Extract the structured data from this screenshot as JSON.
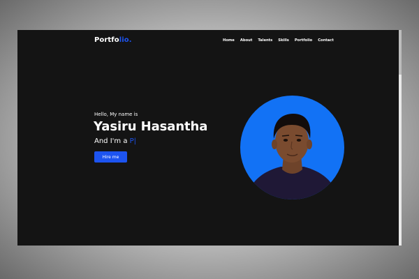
{
  "navbar": {
    "logo_main": "Portfo",
    "logo_accent": "lio.",
    "links": [
      "Home",
      "About",
      "Talents",
      "Skills",
      "Portfolio",
      "Contact"
    ]
  },
  "hero": {
    "greeting": "Hello, My name is",
    "name": "Yasiru Hasantha",
    "role_prefix": "And I'm a ",
    "role_typed": "P",
    "cursor": "|",
    "hire_button": "Hire me"
  },
  "colors": {
    "page_background": "#141414",
    "accent": "#1d54f0",
    "avatar_background": "#1272f5",
    "text": "#ffffff"
  },
  "icons": {
    "avatar": "profile-photo"
  }
}
